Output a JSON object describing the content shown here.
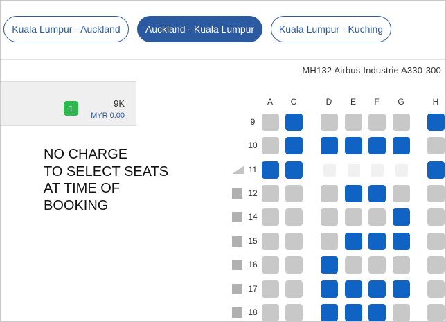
{
  "tabs": [
    {
      "label": "Kuala Lumpur - Auckland",
      "active": false
    },
    {
      "label": "Auckland - Kuala Lumpur",
      "active": true
    },
    {
      "label": "Kuala Lumpur - Kuching",
      "active": false
    }
  ],
  "flight": {
    "title": "MH132 Airbus Industrie A330-300"
  },
  "passenger": {
    "number": "1",
    "seat": "9K",
    "price": "MYR 0.00"
  },
  "note": "NO CHARGE\nTO SELECT SEATS\nAT TIME OF\nBOOKING",
  "columns": [
    "A",
    "C",
    "D",
    "E",
    "F",
    "G",
    "H"
  ],
  "rows": [
    {
      "label": "9",
      "marker": "none",
      "seats": [
        "avail",
        "taken",
        "avail",
        "avail",
        "avail",
        "avail",
        "taken"
      ]
    },
    {
      "label": "10",
      "marker": "none",
      "seats": [
        "avail",
        "taken",
        "taken",
        "taken",
        "taken",
        "taken",
        "avail"
      ]
    },
    {
      "label": "11",
      "marker": "exit",
      "seats": [
        "taken",
        "taken",
        "blank",
        "blank",
        "blank",
        "blank",
        "taken"
      ]
    },
    {
      "label": "12",
      "marker": "box",
      "seats": [
        "avail",
        "avail",
        "avail",
        "taken",
        "taken",
        "avail",
        "avail"
      ]
    },
    {
      "label": "14",
      "marker": "box",
      "seats": [
        "avail",
        "avail",
        "avail",
        "avail",
        "avail",
        "taken",
        "avail"
      ]
    },
    {
      "label": "15",
      "marker": "box",
      "seats": [
        "avail",
        "avail",
        "avail",
        "taken",
        "taken",
        "taken",
        "avail"
      ]
    },
    {
      "label": "16",
      "marker": "box",
      "seats": [
        "avail",
        "avail",
        "taken",
        "avail",
        "avail",
        "avail",
        "avail"
      ]
    },
    {
      "label": "17",
      "marker": "box",
      "seats": [
        "avail",
        "avail",
        "taken",
        "taken",
        "taken",
        "taken",
        "avail"
      ]
    },
    {
      "label": "18",
      "marker": "box",
      "seats": [
        "avail",
        "avail",
        "taken",
        "taken",
        "taken",
        "avail",
        "avail"
      ]
    }
  ],
  "colors": {
    "accent": "#2c5aa0",
    "seat_taken": "#1063c3",
    "seat_available": "#c8c8c8",
    "badge": "#2db84d"
  }
}
